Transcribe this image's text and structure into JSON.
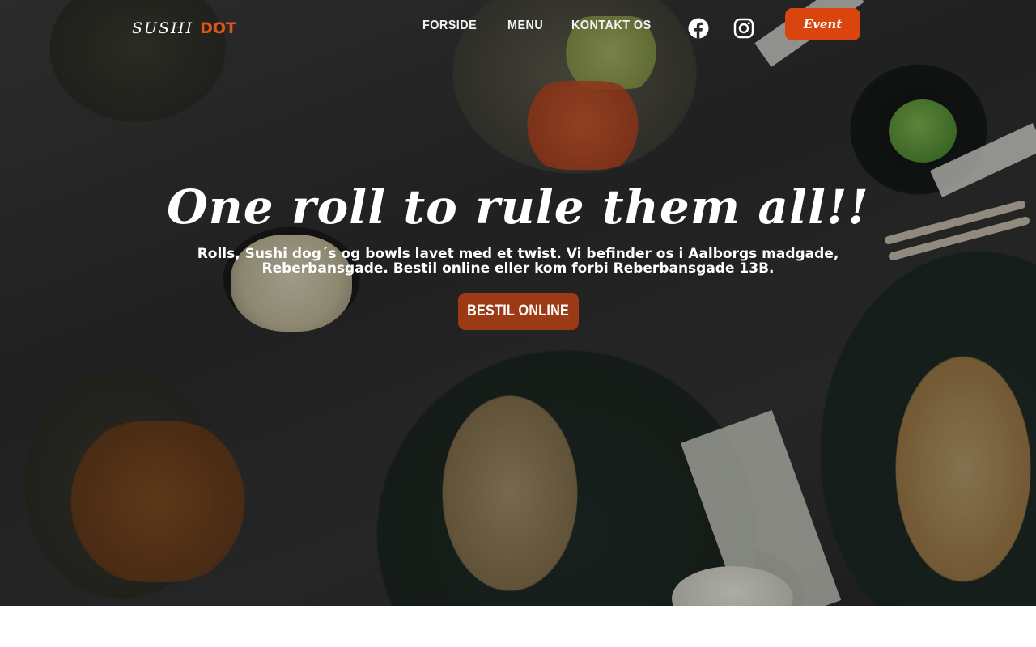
{
  "brand": {
    "logo_word": "SUSHI",
    "logo_accent": "DOT",
    "accent_color": "#e2541b"
  },
  "nav": {
    "items": [
      {
        "label": "FORSIDE"
      },
      {
        "label": "MENU"
      },
      {
        "label": "KONTAKT OS"
      }
    ]
  },
  "social": {
    "facebook_icon": "facebook-icon",
    "instagram_icon": "instagram-icon"
  },
  "header": {
    "event_label": "Event",
    "event_color": "#d9440f"
  },
  "hero": {
    "headline": "One roll to rule them all!!",
    "subtext": "Rolls, Sushi dog´s og bowls lavet med et twist. Vi befinder os i Aalborgs madgade, Reberbansgade. Bestil online eller kom forbi Reberbansgade 13B.",
    "cta_label": "BESTIL ONLINE",
    "cta_color": "#9b3a14"
  }
}
